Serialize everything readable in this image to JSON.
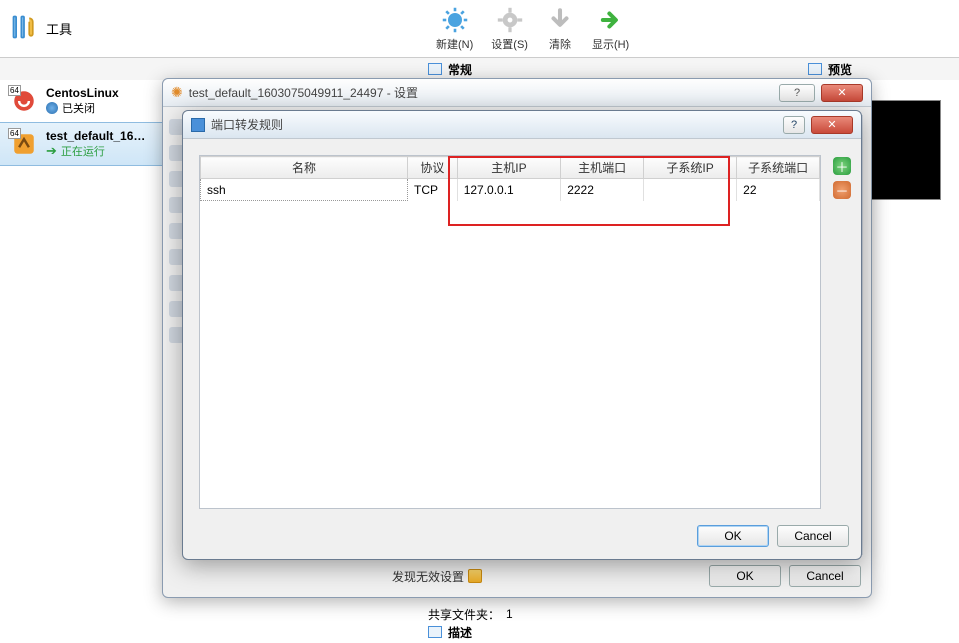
{
  "top": {
    "tools_label": "工具",
    "buttons": {
      "new": "新建(N)",
      "settings": "设置(S)",
      "clear": "清除",
      "show": "显示(H)"
    }
  },
  "sections": {
    "general": "常规",
    "preview": "预览",
    "describe": "描述"
  },
  "vms": [
    {
      "name": "CentosLinux",
      "status_label": "已关闭",
      "badge": "64"
    },
    {
      "name": "test_default_1603075049911_24497",
      "display_name": "test_default_16…",
      "status_label": "正在运行",
      "badge": "64"
    }
  ],
  "outer_dialog": {
    "title": "test_default_1603075049911_24497 - 设置",
    "invalid_msg": "发现无效设置",
    "ok": "OK",
    "cancel": "Cancel"
  },
  "inner_dialog": {
    "title": "端口转发规则",
    "ok": "OK",
    "cancel": "Cancel",
    "columns": {
      "name": "名称",
      "protocol": "协议",
      "host_ip": "主机IP",
      "host_port": "主机端口",
      "guest_ip": "子系统IP",
      "guest_port": "子系统端口"
    },
    "rows": [
      {
        "name": "ssh",
        "protocol": "TCP",
        "host_ip": "127.0.0.1",
        "host_port": "2222",
        "guest_ip": "",
        "guest_port": "22"
      }
    ]
  },
  "bottom": {
    "shared_folders_label": "共享文件夹：",
    "shared_folders_count": "1"
  }
}
